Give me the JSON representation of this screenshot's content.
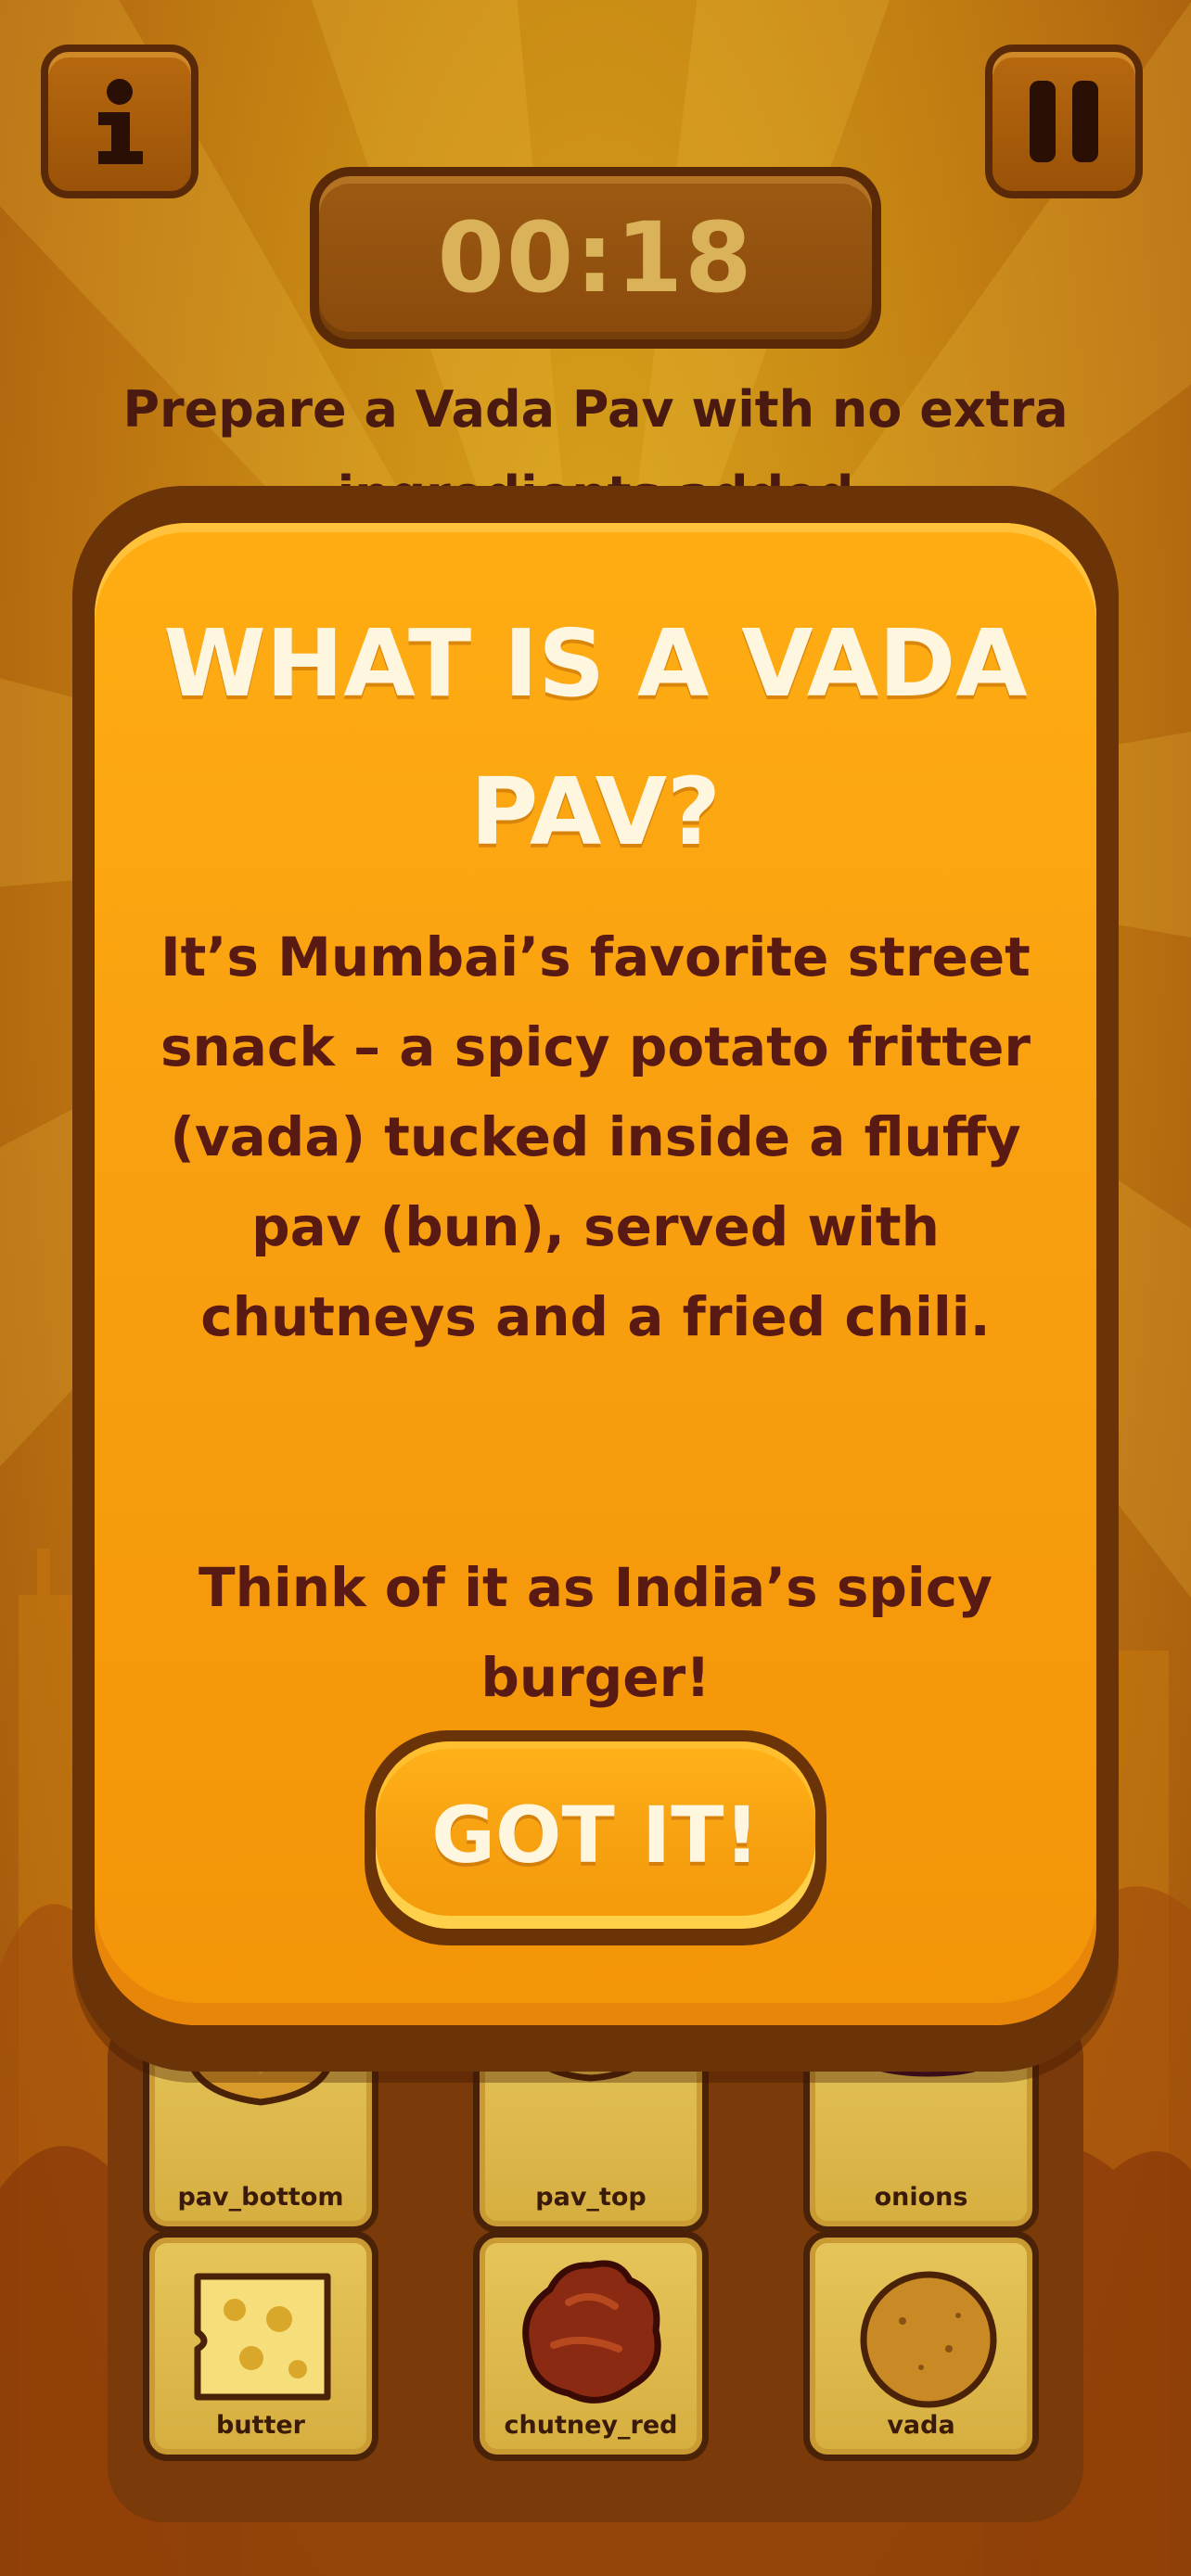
{
  "hud": {
    "info_icon": "info-icon",
    "pause_icon": "pause-icon",
    "timer": "00:18"
  },
  "instruction": "Prepare a Vada Pav with no extra ingredients added",
  "ingredients": [
    {
      "label": "pav_bottom",
      "icon": "bun-bottom-icon"
    },
    {
      "label": "pav_top",
      "icon": "bun-top-icon"
    },
    {
      "label": "onions",
      "icon": "onion-icon"
    },
    {
      "label": "butter",
      "icon": "butter-icon"
    },
    {
      "label": "chutney_red",
      "icon": "chutney-icon"
    },
    {
      "label": "vada",
      "icon": "vada-icon"
    }
  ],
  "modal": {
    "title": "WHAT IS A VADA PAV?",
    "body": "It’s Mumbai’s favorite street snack – a spicy potato fritter (vada) tucked inside a fluffy pav (bun), served with chutneys and a fried chili.",
    "tagline": "Think of it as India’s spicy burger!",
    "button_label": "GOT IT!"
  },
  "colors": {
    "accent_orange": "#f9a010",
    "dark_brown": "#6b3308",
    "text_maroon": "#5a1a14",
    "card_yellow": "#e6c55a"
  }
}
